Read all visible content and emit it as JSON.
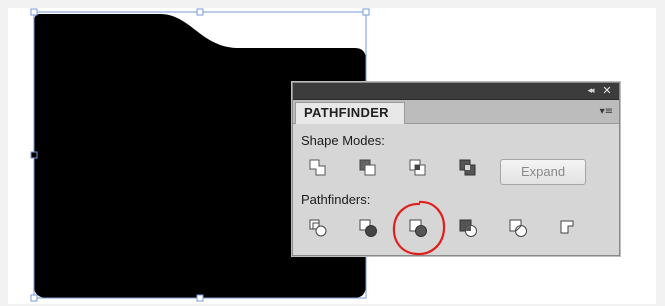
{
  "panel": {
    "title": "PATHFINDER",
    "collapse_icon": "double-chevron-left-icon",
    "collapse_glyph": "◂◂",
    "close_glyph": "✕",
    "menu_glyph": "▾≡",
    "shape_modes_label": "Shape Modes:",
    "pathfinders_label": "Pathfinders:",
    "expand_label": "Expand",
    "shape_modes": [
      {
        "name": "unite",
        "icon": "unite-icon"
      },
      {
        "name": "minus-front",
        "icon": "minus-front-icon"
      },
      {
        "name": "intersect",
        "icon": "intersect-icon"
      },
      {
        "name": "exclude",
        "icon": "exclude-icon"
      }
    ],
    "pathfinders": [
      {
        "name": "divide",
        "icon": "divide-icon"
      },
      {
        "name": "trim",
        "icon": "trim-icon"
      },
      {
        "name": "merge",
        "icon": "merge-icon",
        "highlighted": true
      },
      {
        "name": "crop",
        "icon": "crop-icon"
      },
      {
        "name": "outline",
        "icon": "outline-icon"
      },
      {
        "name": "minus-back",
        "icon": "minus-back-icon"
      }
    ]
  },
  "colors": {
    "shape_fill": "#000000",
    "selection_line": "#7a9ad8",
    "highlight_ring": "#e0201a"
  }
}
